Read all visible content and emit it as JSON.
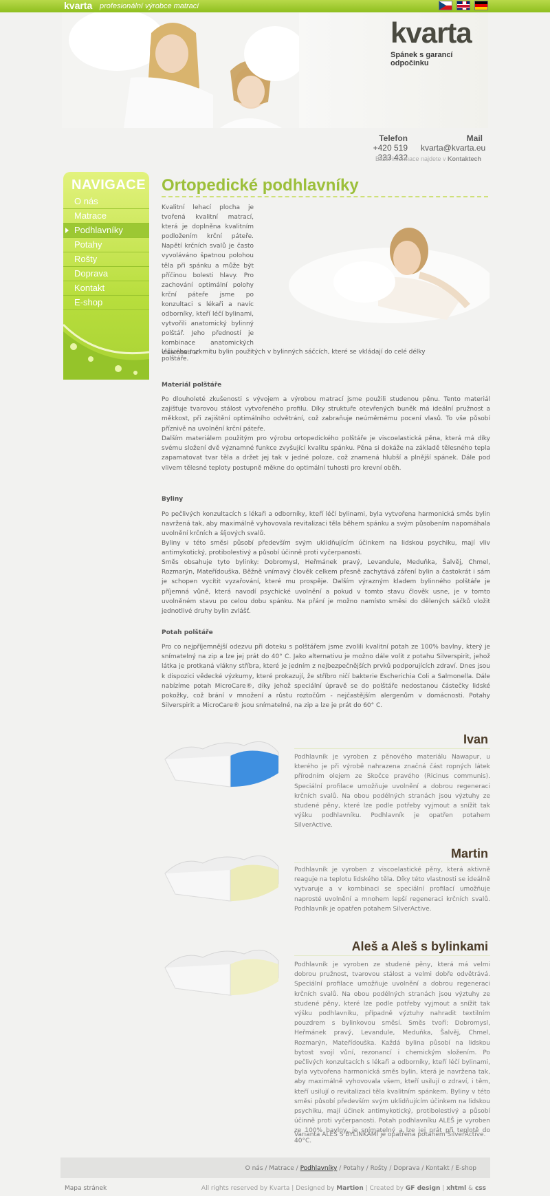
{
  "topbar": {
    "brand": "kvarta",
    "tagline": "profesionální výrobce matrací"
  },
  "flags": [
    "cz-flag-icon",
    "uk-flag-icon",
    "de-flag-icon"
  ],
  "header": {
    "logo": "kvarta",
    "slogan": "Spánek s garancí odpočinku",
    "phone_label": "Telefon",
    "phone": "+420 519 333 432",
    "mail_label": "Mail",
    "mail": "kvarta@kvarta.eu",
    "more_info_prefix": "Bližší informace najdete v ",
    "more_info_link": "Kontaktech"
  },
  "nav": {
    "heading": "NAVIGACE",
    "items": [
      "O nás",
      "Matrace",
      "Podhlavníky",
      "Potahy",
      "Rošty",
      "Doprava",
      "Kontakt",
      "E-shop"
    ],
    "active": "Podhlavníky"
  },
  "main": {
    "title": "Ortopedické podhlavníky",
    "intro": "Kvalitní lehací plocha je tvořená kvalitní matrací, která je doplněna kvalitním podložením krční páteře. Napětí krčních svalů je často vyvoláváno špatnou polohou těla při spánku a může být příčinou bolesti hlavy. Pro zachování optimální polohy krční páteře jsme po konzultaci s lékaři a navíc odborníky, kteří léčí bylinami, vytvořili anatomický bylinný polštář. Jeho předností je kombinace anatomických vlastností a",
    "intro_tail": "léčivého rozkmitu bylin použitých v bylinných sáčcích, které se vkládají do celé délky polštáře.",
    "sections": [
      {
        "heading": "Materiál polštáře",
        "paragraphs": [
          "Po dlouholeté zkušenosti s vývojem a výrobou matrací jsme použili studenou pěnu. Tento materiál zajišťuje tvarovou stálost vytvořeného profilu. Díky struktuře otevřených buněk má ideální pružnost a měkkost, při zajištění optimálního odvětrání, což zabraňuje neúměrnému pocení vlasů. To vše působí příznivě na uvolnění krční páteře.",
          "Dalším materiálem použitým pro výrobu ortopedického polštáře je viscoelastická pěna, která má díky svému složení dvě významné funkce zvyšující kvalitu spánku. Pěna si dokáže na základě tělesného tepla zapamatovat tvar těla a držet jej tak v jedné poloze, což znamená hlubší a plnější spánek. Dále pod vlivem tělesné teploty postupně měkne do optimální tuhosti pro krevní oběh."
        ]
      },
      {
        "heading": "Byliny",
        "paragraphs": [
          "Po pečlivých konzultacích s lékaři a odborníky, kteří léčí bylinami, byla vytvořena harmonická směs bylin navržená tak, aby maximálně vyhovovala revitalizaci těla během spánku a svým působením napomáhala uvolnění krčních a šíjových svalů.",
          "Byliny v této směsi působí především svým uklidňujícím účinkem na lidskou psychiku, mají vliv antimykotický, protibolestivý a působí účinně proti vyčerpanosti.",
          "Směs obsahuje tyto bylinky: Dobromysl, Heřmánek pravý, Levandule, Meduňka, Šalvěj, Chmel, Rozmarýn, Mateřídouška. Běžně vnímavý člověk celkem přesně zachytává záření bylin a častokrát i sám je schopen vycítit vyzařování, které mu prospěje. Dalším výrazným kladem bylinného polštáře je příjemná vůně, která navodí psychické uvolnění a pokud v tomto stavu člověk usne, je v tomto uvolněném stavu po celou dobu spánku. Na přání je možno namísto směsi do dělených sáčků vložit jednotlivé druhy bylin zvlášť."
        ]
      },
      {
        "heading": "Potah polštáře",
        "paragraphs": [
          "Pro co nejpříjemnější odezvu při doteku s polštářem jsme zvolili kvalitní potah ze 100% bavlny, který je snímatelný na zip a lze jej prát do 40° C. Jako alternativu je možno dále volit z potahu Silverspirit, jehož látka je protkaná vlákny stříbra, které je jedním z nejbezpečnějších prvků podporujících zdraví. Dnes jsou k dispozici vědecké výzkumy, které prokazují, že stříbro ničí bakterie Escherichia Coli a Salmonella. Dále nabízíme potah MicroCare®, díky jehož speciální úpravě se do polštáře nedostanou částečky lidské pokožky, což brání v množení a růstu roztočům - nejčastějším alergenům v domácnosti. Potahy Silverspirit a MicroCare® jsou snímatelné, na zip a lze je prát do 60° C."
        ]
      }
    ],
    "products": [
      {
        "name": "Ivan",
        "text": "Podhlavník je vyroben z pěnového materiálu Nawapur, u kterého je při výrobě nahrazena značná část ropných látek přírodním olejem ze Skočce pravého (Ricinus communis). Speciální profilace umožňuje uvolnění a dobrou regeneraci krčních svalů. Na obou podélných stranách jsou výztuhy ze studené pěny, které lze podle potřeby vyjmout a snížit tak výšku podhlavníku. Podhlavník je opatřen potahem SilverActive."
      },
      {
        "name": "Martin",
        "text": "Podhlavník je vyroben z viscoelastické pěny, která aktivně reaguje na teplotu lidského těla. Díky této vlastnosti se ideálně vytvaruje a v kombinaci se speciální profilací umožňuje naprosté uvolnění a mnohem lepší regeneraci krčních svalů. Podhlavník je opatřen potahem SilverActive."
      },
      {
        "name": "Aleš a Aleš s bylinkami",
        "text": "Podhlavník je vyroben ze studené pěny, která má velmi dobrou pružnost, tvarovou stálost a velmi dobře odvětrává. Speciální profilace umožňuje uvolnění a dobrou regeneraci krčních svalů. Na obou podélných stranách jsou výztuhy ze studené pěny, které lze podle potřeby vyjmout a snížit tak výšku podhlavníku, případně výztuhy nahradit textilním pouzdrem s bylinkovou směsí. Směs tvoří: Dobromysl, Heřmánek pravý, Levandule, Meduňka, Šalvěj, Chmel, Rozmarýn, Mateřídouška. Každá bylina působí na lidskou bytost svojí vůní, rezonancí i chemickým složením. Po pečlivých konzultacích s lékaři a odborníky, kteří léčí bylinami, byla vytvořena harmonická směs bylin, která je navržena tak, aby maximálně vyhovovala všem, kteří usilují o zdraví, i těm, kteří usilují o revitalizaci těla kvalitním spánkem. Byliny v této směsi působí především svým uklidňujícím účinkem na lidskou psychiku, mají účinek antimykotický, protibolestivý a působí účinně proti vyčerpanosti. Potah podhlavníku ALEŠ je vyroben ze 100% bavlny, je snímatelný a lze jej prát při teplotě do 40°C.",
        "note": "Varianta ALEŠ S BYLINKAMI je opatřena potahem SilverActive."
      }
    ]
  },
  "footer": {
    "links": [
      "O nás",
      "Matrace",
      "Podhlavníky",
      "Potahy",
      "Rošty",
      "Doprava",
      "Kontakt",
      "E-shop"
    ],
    "current": "Podhlavníky",
    "sitemap": "Mapa stránek",
    "rights": "All rights reserved by Kvarta",
    "designed_by_label": "Designed by",
    "designed_by": "Martion",
    "created_by_label": "Created by",
    "created_by": "GF design",
    "xhtml": "xhtml",
    "css": "css"
  }
}
